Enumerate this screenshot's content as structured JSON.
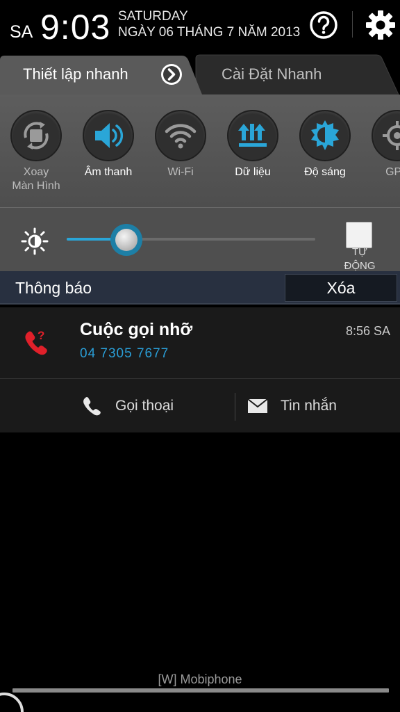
{
  "status": {
    "ampm": "SA",
    "time": "9:03",
    "day": "SATURDAY",
    "date": "NGÀY 06 THÁNG 7 NĂM 2013"
  },
  "tabs": {
    "active": "Thiết lập nhanh",
    "inactive": "Cài Đặt Nhanh"
  },
  "quick_settings": [
    {
      "label_line1": "Xoay",
      "label_line2": "Màn Hình",
      "icon": "rotate-icon",
      "state": "off"
    },
    {
      "label_line1": "Âm thanh",
      "label_line2": "",
      "icon": "sound-icon",
      "state": "on"
    },
    {
      "label_line1": "Wi-Fi",
      "label_line2": "",
      "icon": "wifi-icon",
      "state": "off"
    },
    {
      "label_line1": "Dữ liệu",
      "label_line2": "",
      "icon": "data-icon",
      "state": "on"
    },
    {
      "label_line1": "Độ sáng",
      "label_line2": "",
      "icon": "brightness-icon",
      "state": "on"
    },
    {
      "label_line1": "GPS",
      "label_line2": "",
      "icon": "gps-icon",
      "state": "off"
    }
  ],
  "brightness": {
    "level": 0.24,
    "auto_line1": "TỰ",
    "auto_line2": "ĐỘNG"
  },
  "notifications": {
    "title": "Thông báo",
    "clear_label": "Xóa",
    "items": [
      {
        "title": "Cuộc gọi nhỡ",
        "number": "04 7305 7677",
        "time": "8:56 SA",
        "actions": {
          "call": "Gọi thoại",
          "message": "Tin nhắn"
        }
      }
    ]
  },
  "carrier": "[W] Mobiphone",
  "colors": {
    "accent": "#2aa6d8",
    "missed_call": "#e0202a",
    "panel_bg": "#555555",
    "notif_header_bg": "#283040"
  }
}
